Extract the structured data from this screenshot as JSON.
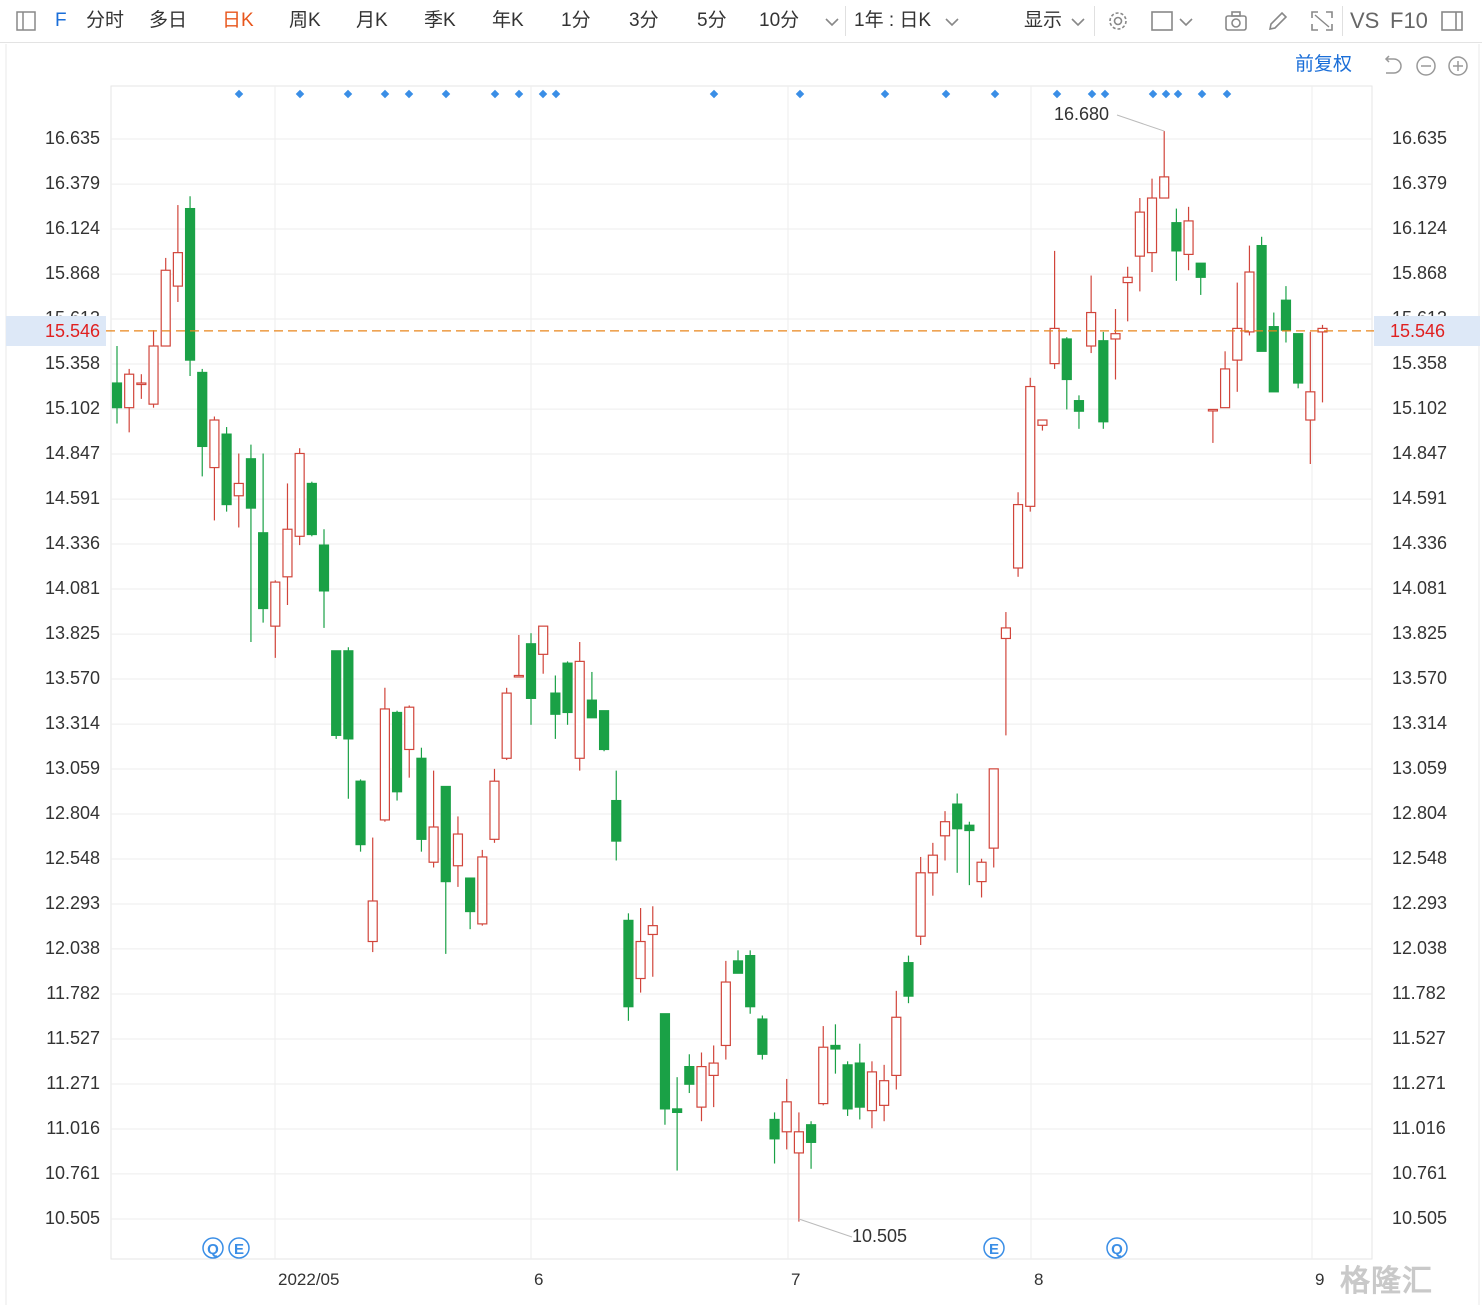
{
  "toolbar": {
    "symbol": "F",
    "tabs": [
      "分时",
      "多日",
      "日K",
      "周K",
      "月K",
      "季K",
      "年K",
      "1分",
      "3分",
      "5分",
      "10分"
    ],
    "active_tab": "日K",
    "range_label": "1年 : 日K",
    "display_label": "显示",
    "vs_label": "VS",
    "f10_label": "F10"
  },
  "subbar": {
    "adjust_label": "前复权"
  },
  "current_price": "15.546",
  "annotations": {
    "high_label": "16.680",
    "low_label": "10.505"
  },
  "watermark": "格隆汇",
  "chart_data": {
    "type": "candlestick",
    "y_ticks": [
      "16.635",
      "16.379",
      "16.124",
      "15.868",
      "15.613",
      "15.358",
      "15.102",
      "14.847",
      "14.591",
      "14.336",
      "14.081",
      "13.825",
      "13.570",
      "13.314",
      "13.059",
      "12.804",
      "12.548",
      "12.293",
      "12.038",
      "11.782",
      "11.527",
      "11.271",
      "11.016",
      "10.761",
      "10.505"
    ],
    "x_ticks": [
      "2022/05",
      "6",
      "7",
      "8",
      "9"
    ],
    "ylim": [
      10.505,
      16.635
    ],
    "current_price": 15.546,
    "max": 16.68,
    "min": 10.505,
    "event_markers": [
      "Q",
      "E",
      "E",
      "Q"
    ],
    "candles": [
      [
        15.25,
        15.11,
        15.46,
        15.02
      ],
      [
        15.11,
        15.3,
        15.33,
        14.97
      ],
      [
        15.25,
        15.25,
        15.3,
        15.16
      ],
      [
        15.13,
        15.46,
        15.55,
        15.11
      ],
      [
        15.46,
        15.89,
        15.96,
        15.46
      ],
      [
        15.8,
        15.99,
        16.26,
        15.71
      ],
      [
        16.24,
        15.38,
        16.31,
        15.29
      ],
      [
        15.31,
        14.89,
        15.33,
        14.72
      ],
      [
        14.77,
        15.04,
        15.06,
        14.47
      ],
      [
        14.96,
        14.56,
        15.0,
        14.52
      ],
      [
        14.61,
        14.68,
        14.85,
        14.43
      ],
      [
        14.82,
        14.54,
        14.9,
        13.78
      ],
      [
        14.4,
        13.97,
        14.85,
        13.89
      ],
      [
        13.87,
        14.12,
        14.13,
        13.69
      ],
      [
        14.15,
        14.42,
        14.68,
        13.99
      ],
      [
        14.38,
        14.85,
        14.88,
        14.33
      ],
      [
        14.68,
        14.39,
        14.69,
        14.38
      ],
      [
        14.33,
        14.07,
        14.42,
        13.86
      ],
      [
        13.73,
        13.25,
        13.73,
        13.23
      ],
      [
        13.73,
        13.23,
        13.75,
        12.89
      ],
      [
        12.99,
        12.63,
        13.0,
        12.59
      ],
      [
        12.08,
        12.31,
        12.67,
        12.02
      ],
      [
        12.77,
        13.4,
        13.52,
        12.76
      ],
      [
        13.38,
        12.93,
        13.39,
        12.88
      ],
      [
        13.17,
        13.41,
        13.42,
        13.01
      ],
      [
        13.12,
        12.66,
        13.18,
        12.59
      ],
      [
        12.53,
        12.73,
        13.05,
        12.5
      ],
      [
        12.96,
        12.42,
        12.96,
        12.01
      ],
      [
        12.51,
        12.69,
        12.79,
        12.39
      ],
      [
        12.44,
        12.25,
        12.44,
        12.15
      ],
      [
        12.18,
        12.56,
        12.6,
        12.17
      ],
      [
        12.66,
        12.99,
        13.06,
        12.64
      ],
      [
        13.12,
        13.49,
        13.52,
        13.11
      ],
      [
        13.59,
        13.59,
        13.82,
        13.59
      ],
      [
        13.77,
        13.46,
        13.83,
        13.31
      ],
      [
        13.71,
        13.87,
        13.87,
        13.6
      ],
      [
        13.49,
        13.37,
        13.59,
        13.23
      ],
      [
        13.66,
        13.38,
        13.67,
        13.31
      ],
      [
        13.12,
        13.67,
        13.78,
        13.05
      ],
      [
        13.45,
        13.35,
        13.61,
        13.35
      ],
      [
        13.39,
        13.17,
        13.39,
        13.16
      ],
      [
        12.88,
        12.65,
        13.05,
        12.54
      ],
      [
        12.2,
        11.71,
        12.24,
        11.63
      ],
      [
        11.87,
        12.08,
        12.27,
        11.79
      ],
      [
        12.12,
        12.17,
        12.28,
        11.88
      ],
      [
        11.67,
        11.13,
        11.67,
        11.04
      ],
      [
        11.13,
        11.11,
        11.31,
        10.78
      ],
      [
        11.37,
        11.27,
        11.44,
        11.22
      ],
      [
        11.14,
        11.37,
        11.45,
        11.06
      ],
      [
        11.32,
        11.39,
        11.49,
        11.14
      ],
      [
        11.49,
        11.85,
        11.97,
        11.41
      ],
      [
        11.97,
        11.9,
        12.03,
        11.9
      ],
      [
        12.0,
        11.71,
        12.03,
        11.67
      ],
      [
        11.64,
        11.44,
        11.66,
        11.41
      ],
      [
        11.07,
        10.96,
        11.11,
        10.82
      ],
      [
        11.0,
        11.17,
        11.3,
        10.9
      ],
      [
        10.88,
        11.0,
        11.11,
        10.49
      ],
      [
        11.04,
        10.94,
        11.06,
        10.79
      ],
      [
        11.16,
        11.48,
        11.6,
        11.15
      ],
      [
        11.49,
        11.47,
        11.61,
        11.33
      ],
      [
        11.38,
        11.13,
        11.4,
        11.09
      ],
      [
        11.39,
        11.14,
        11.5,
        11.07
      ],
      [
        11.12,
        11.34,
        11.4,
        11.02
      ],
      [
        11.15,
        11.29,
        11.38,
        11.06
      ],
      [
        11.32,
        11.65,
        11.8,
        11.24
      ],
      [
        11.96,
        11.77,
        12.0,
        11.73
      ],
      [
        12.11,
        12.47,
        12.56,
        12.06
      ],
      [
        12.47,
        12.57,
        12.64,
        12.34
      ],
      [
        12.68,
        12.76,
        12.82,
        12.54
      ],
      [
        12.86,
        12.72,
        12.92,
        12.47
      ],
      [
        12.74,
        12.71,
        12.76,
        12.4
      ],
      [
        12.42,
        12.53,
        12.55,
        12.33
      ],
      [
        12.61,
        13.06,
        13.06,
        12.5
      ],
      [
        13.8,
        13.86,
        13.95,
        13.25
      ],
      [
        14.2,
        14.56,
        14.63,
        14.15
      ],
      [
        14.55,
        15.23,
        15.28,
        14.52
      ],
      [
        15.01,
        15.04,
        15.04,
        14.98
      ],
      [
        15.36,
        15.56,
        16.0,
        15.33
      ],
      [
        15.5,
        15.27,
        15.51,
        15.1
      ],
      [
        15.15,
        15.09,
        15.18,
        14.99
      ],
      [
        15.46,
        15.65,
        15.86,
        15.42
      ],
      [
        15.49,
        15.03,
        15.54,
        14.99
      ],
      [
        15.5,
        15.53,
        15.67,
        15.27
      ],
      [
        15.82,
        15.85,
        15.91,
        15.6
      ],
      [
        15.97,
        16.22,
        16.3,
        15.77
      ],
      [
        15.99,
        16.3,
        16.41,
        15.88
      ],
      [
        16.3,
        16.42,
        16.68,
        16.35
      ],
      [
        16.16,
        16.0,
        16.24,
        15.83
      ],
      [
        15.98,
        16.17,
        16.25,
        15.89
      ],
      [
        15.93,
        15.85,
        15.93,
        15.75
      ],
      [
        15.1,
        15.1,
        15.1,
        14.91
      ],
      [
        15.11,
        15.33,
        15.43,
        15.11
      ],
      [
        15.38,
        15.56,
        15.82,
        15.2
      ],
      [
        15.54,
        15.88,
        16.03,
        15.52
      ],
      [
        16.03,
        15.43,
        16.08,
        15.43
      ],
      [
        15.57,
        15.2,
        15.65,
        15.2
      ],
      [
        15.72,
        15.55,
        15.8,
        15.48
      ],
      [
        15.53,
        15.25,
        15.53,
        15.22
      ],
      [
        15.04,
        15.2,
        15.54,
        14.79
      ],
      [
        15.54,
        15.56,
        15.58,
        15.14
      ]
    ]
  }
}
